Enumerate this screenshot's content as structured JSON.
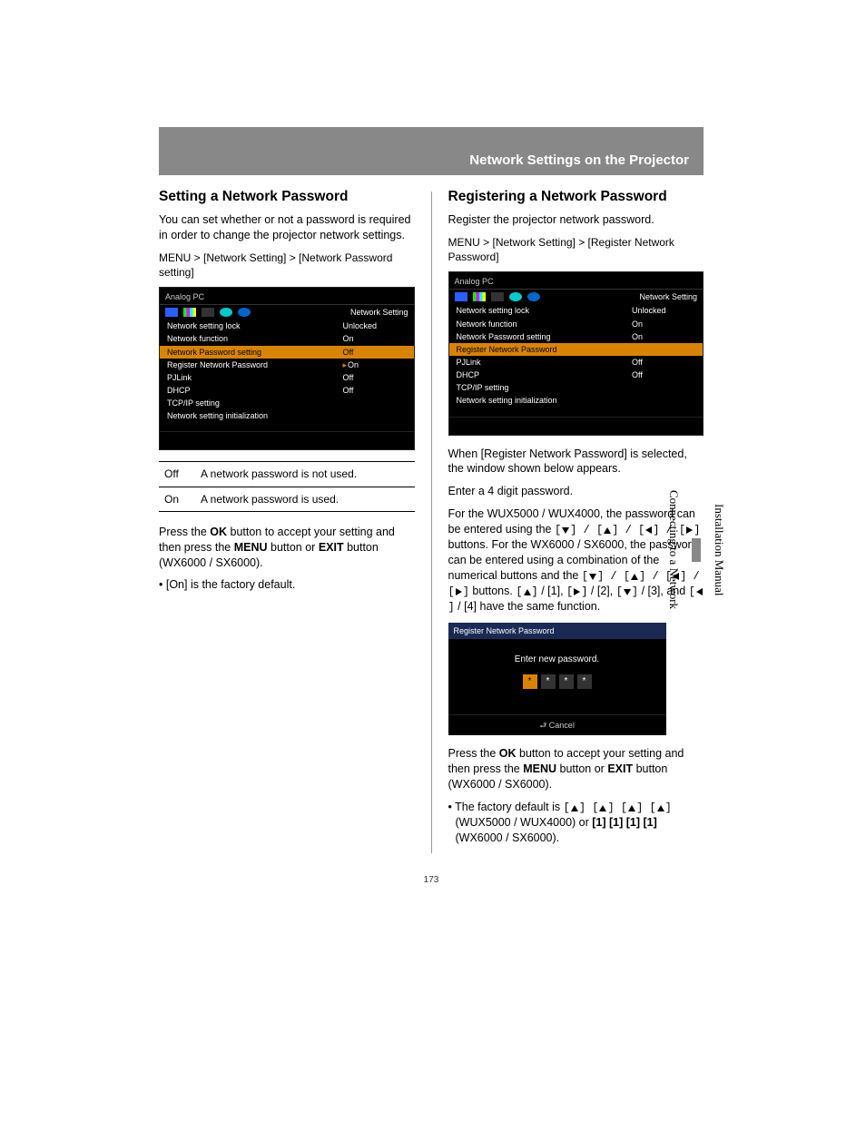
{
  "header": {
    "title": "Network Settings on the Projector"
  },
  "page_number": "173",
  "side_tabs": {
    "top": "Installation Manual",
    "bottom": "Connecting to a Network"
  },
  "left": {
    "heading": "Setting a Network Password",
    "intro": "You can set whether or not a password is required in order to change the projector network settings.",
    "menu_path": "MENU > [Network Setting] > [Network Password setting]",
    "osd": {
      "source": "Analog PC",
      "tab_title": "Network Setting",
      "rows": [
        {
          "label": "Network setting lock",
          "val": "Unlocked",
          "hl": false
        },
        {
          "label": "Network function",
          "val": "On",
          "hl": false
        },
        {
          "label": "Network Password setting",
          "val": "Off",
          "hl": true
        },
        {
          "label": "Register Network Password",
          "val": "On",
          "hl": false,
          "sel": true
        },
        {
          "label": "PJLink",
          "val": "Off",
          "hl": false
        },
        {
          "label": "DHCP",
          "val": "Off",
          "hl": false
        },
        {
          "label": "TCP/IP setting",
          "val": "",
          "hl": false
        },
        {
          "label": "Network setting initialization",
          "val": "",
          "hl": false
        }
      ]
    },
    "options": [
      {
        "key": "Off",
        "desc": "A network password is not used."
      },
      {
        "key": "On",
        "desc": "A network password is used."
      }
    ],
    "accept_pre": "Press the ",
    "accept_ok": "OK",
    "accept_mid": " button to accept your setting and then press the ",
    "accept_menu": "MENU",
    "accept_or": " button or ",
    "accept_exit": "EXIT",
    "accept_post": " button (WX6000 / SX6000).",
    "note": "[On] is the factory default."
  },
  "right": {
    "heading": "Registering a Network Password",
    "intro": "Register the projector network password.",
    "menu_path": "MENU > [Network Setting] > [Register Network Password]",
    "osd": {
      "source": "Analog PC",
      "tab_title": "Network Setting",
      "rows": [
        {
          "label": "Network setting lock",
          "val": "Unlocked",
          "hl": false
        },
        {
          "label": "Network function",
          "val": "On",
          "hl": false
        },
        {
          "label": "Network Password setting",
          "val": "On",
          "hl": false
        },
        {
          "label": "Register Network Password",
          "val": "",
          "hl": true
        },
        {
          "label": "PJLink",
          "val": "Off",
          "hl": false
        },
        {
          "label": "DHCP",
          "val": "Off",
          "hl": false
        },
        {
          "label": "TCP/IP setting",
          "val": "",
          "hl": false
        },
        {
          "label": "Network setting initialization",
          "val": "",
          "hl": false
        }
      ]
    },
    "after_osd1": "When [Register Network Password] is selected, the window shown below appears.",
    "after_osd2": "Enter a 4 digit password.",
    "para_a": "For the WUX5000 / WUX4000, the password can be entered using the ",
    "para_b": " buttons. For the WX6000 / SX6000, the password can be entered using a combination of the numerical buttons and the ",
    "para_c": " buttons.",
    "para_d1": " / [1], ",
    "para_d2": " / [2], ",
    "para_d3": " / [3], and ",
    "para_d4": " / [4] have the same function.",
    "pw_dialog": {
      "title": "Register Network Password",
      "prompt": "Enter new password.",
      "slots": [
        "*",
        "*",
        "*",
        "*"
      ],
      "cancel": "Cancel"
    },
    "accept_pre": "Press the ",
    "accept_ok": "OK",
    "accept_mid": " button to accept your setting and then press the ",
    "accept_menu": "MENU",
    "accept_or": " button or ",
    "accept_exit": "EXIT",
    "accept_post": " button (WX6000 / SX6000).",
    "note_pre": "The factory default is ",
    "note_mid": " (WUX5000 / WUX4000) or ",
    "note_ones": "[1] [1] [1] [1]",
    "note_post": " (WX6000 / SX6000)."
  }
}
